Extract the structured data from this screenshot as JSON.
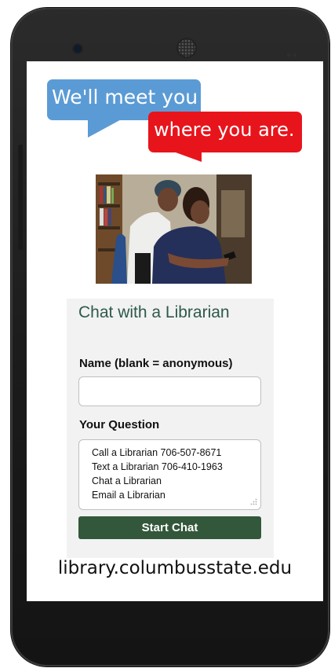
{
  "bubbles": {
    "blue_text": "We'll meet you",
    "red_text": "where you are."
  },
  "chat": {
    "title": "Chat with a Librarian",
    "name_label": "Name (blank = anonymous)",
    "name_value": "",
    "question_label": "Your Question",
    "question_lines": [
      "Call a Librarian 706-507-8671",
      "Text a Librarian 706-410-1963",
      "Chat a Librarian",
      "Email a Librarian"
    ],
    "start_button": "Start Chat"
  },
  "footer": {
    "url": "library.columbusstate.edu"
  },
  "colors": {
    "blue_bubble": "#5b9bd5",
    "red_bubble": "#e8141c",
    "title_green": "#2e5a4a",
    "button_green": "#33573a"
  },
  "icons": [
    "camera-icon",
    "speaker-icon",
    "resize-grip-icon"
  ]
}
